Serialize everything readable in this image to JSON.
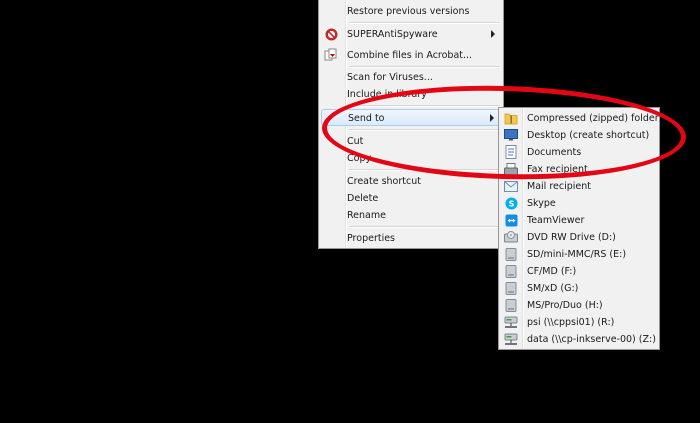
{
  "context_menu": {
    "items": [
      {
        "label": "Restore previous versions"
      },
      {
        "label": "SUPERAntiSpyware",
        "icon": "superantispyware-icon"
      },
      {
        "label": "Combine files in Acrobat...",
        "icon": "acrobat-combine-icon"
      },
      {
        "label": "Scan for Viruses..."
      },
      {
        "label": "Include in library"
      },
      {
        "label": "Send to"
      },
      {
        "label": "Cut"
      },
      {
        "label": "Copy"
      },
      {
        "label": "Create shortcut"
      },
      {
        "label": "Delete"
      },
      {
        "label": "Rename"
      },
      {
        "label": "Properties"
      }
    ]
  },
  "send_to_menu": {
    "items": [
      {
        "label": "Compressed (zipped) folder",
        "icon": "zip-folder-icon"
      },
      {
        "label": "Desktop (create shortcut)",
        "icon": "desktop-icon"
      },
      {
        "label": "Documents",
        "icon": "documents-icon"
      },
      {
        "label": "Fax recipient",
        "icon": "fax-icon"
      },
      {
        "label": "Mail recipient",
        "icon": "mail-icon"
      },
      {
        "label": "Skype",
        "icon": "skype-icon"
      },
      {
        "label": "TeamViewer",
        "icon": "teamviewer-icon"
      },
      {
        "label": "DVD RW Drive (D:)",
        "icon": "dvd-drive-icon"
      },
      {
        "label": "SD/mini-MMC/RS (E:)",
        "icon": "removable-drive-icon"
      },
      {
        "label": "CF/MD (F:)",
        "icon": "removable-drive-icon"
      },
      {
        "label": "SM/xD (G:)",
        "icon": "removable-drive-icon"
      },
      {
        "label": "MS/Pro/Duo (H:)",
        "icon": "removable-drive-icon"
      },
      {
        "label": "psi (\\\\cppsi01) (R:)",
        "icon": "network-drive-icon"
      },
      {
        "label": "data (\\\\cp-inkserve-00) (Z:)",
        "icon": "network-drive-icon"
      }
    ]
  },
  "annotation": {
    "shape": "ellipse",
    "color": "#e30613"
  },
  "colors": {
    "background": "#000000",
    "menu_bg": "#f1f1f1",
    "highlight_border": "#a8cdf2"
  }
}
